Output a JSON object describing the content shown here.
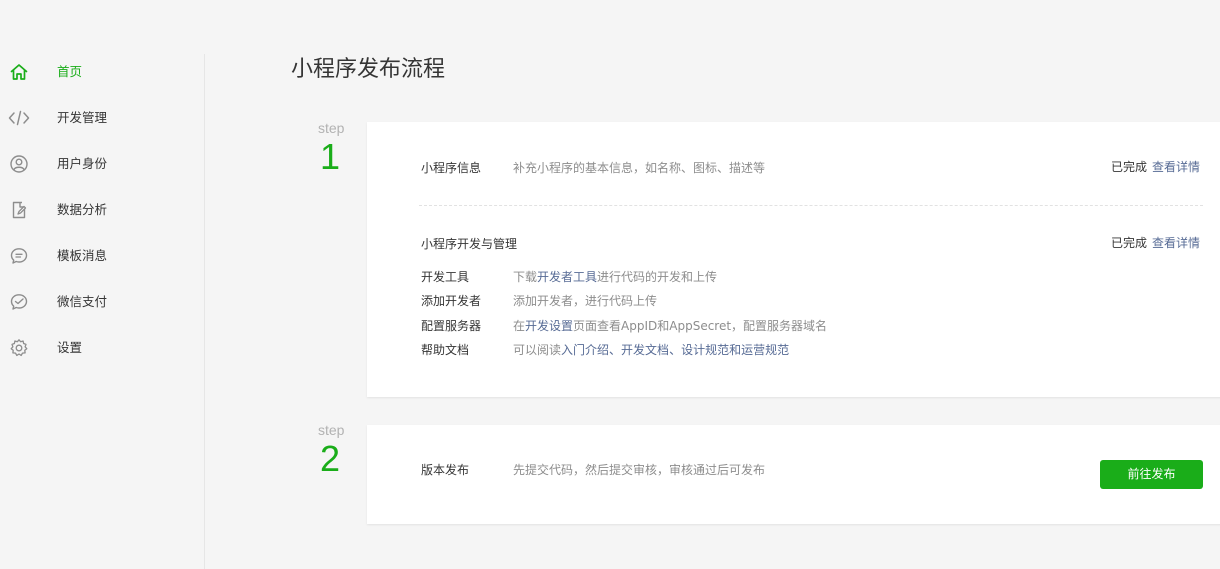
{
  "sidebar": {
    "items": [
      {
        "label": "首页",
        "icon": "home-icon",
        "active": true
      },
      {
        "label": "开发管理",
        "icon": "code-icon"
      },
      {
        "label": "用户身份",
        "icon": "user-icon"
      },
      {
        "label": "数据分析",
        "icon": "file-edit-icon"
      },
      {
        "label": "模板消息",
        "icon": "message-icon"
      },
      {
        "label": "微信支付",
        "icon": "payment-icon"
      },
      {
        "label": "设置",
        "icon": "gear-icon"
      }
    ]
  },
  "main": {
    "title": "小程序发布流程",
    "steps": [
      {
        "word": "step",
        "number": "1",
        "sections": {
          "info": {
            "label": "小程序信息",
            "desc": "补充小程序的基本信息，如名称、图标、描述等",
            "status": "已完成",
            "link": "查看详情"
          },
          "dev": {
            "label": "小程序开发与管理",
            "status": "已完成",
            "link": "查看详情",
            "rows": {
              "tools": {
                "label": "开发工具",
                "pre": "下载",
                "link": "开发者工具",
                "post": "进行代码的开发和上传"
              },
              "add_dev": {
                "label": "添加开发者",
                "desc": "添加开发者，进行代码上传"
              },
              "server": {
                "label": "配置服务器",
                "pre": "在",
                "link": "开发设置",
                "post": "页面查看AppID和AppSecret，配置服务器域名"
              },
              "docs": {
                "label": "帮助文档",
                "pre": "可以阅读",
                "link1": "入门介绍",
                "sep1": "、",
                "link2": "开发文档",
                "sep2": "、",
                "link3": "设计规范",
                "sep3": "和",
                "link4": "运营规范"
              }
            }
          }
        }
      },
      {
        "word": "step",
        "number": "2",
        "release": {
          "label": "版本发布",
          "desc": "先提交代码，然后提交审核，审核通过后可发布",
          "button": "前往发布"
        }
      }
    ]
  },
  "colors": {
    "accent": "#1aad19",
    "link": "#576b95",
    "muted": "#8d8d8d",
    "text": "#353535"
  }
}
